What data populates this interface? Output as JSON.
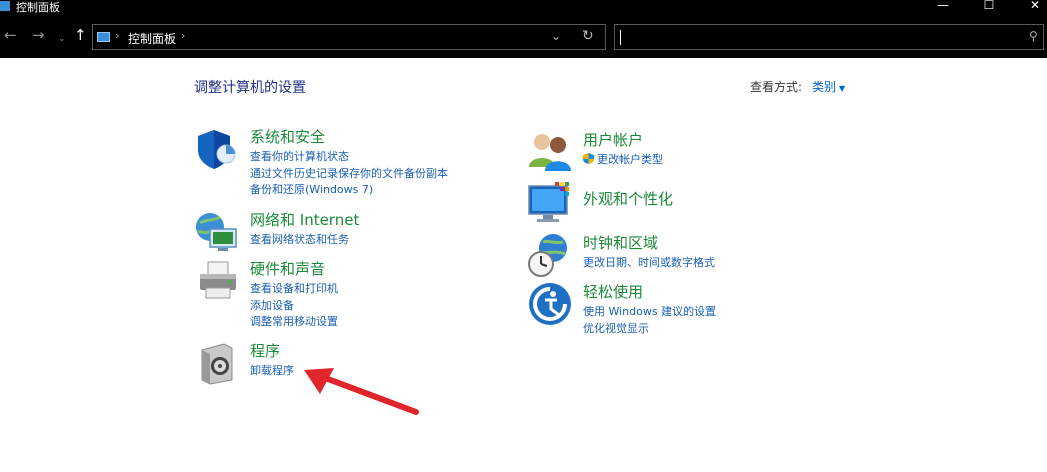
{
  "window": {
    "title": "控制面板",
    "minimize_glyph": "—",
    "maximize_glyph": "☐",
    "close_glyph": "✕"
  },
  "address_bar": {
    "back_glyph": "←",
    "forward_glyph": "→",
    "recent_glyph": "⌄",
    "up_glyph": "↑",
    "separator_glyph": "›",
    "breadcrumb": "控制面板",
    "dropdown_glyph": "⌄",
    "refresh_glyph": "↻",
    "search_value": "",
    "search_glyph": "⚲"
  },
  "header": {
    "title": "调整计算机的设置",
    "view_label": "查看方式:",
    "view_value": "类别",
    "view_arrow": "▼"
  },
  "categories_left": [
    {
      "title": "系统和安全",
      "icon": "shield-icon",
      "links": [
        "查看你的计算机状态",
        "通过文件历史记录保存你的文件备份副本",
        "备份和还原(Windows 7)"
      ]
    },
    {
      "title": "网络和 Internet",
      "icon": "network-globe-icon",
      "links": [
        "查看网络状态和任务"
      ]
    },
    {
      "title": "硬件和声音",
      "icon": "printer-icon",
      "links": [
        "查看设备和打印机",
        "添加设备",
        "调整常用移动设置"
      ]
    },
    {
      "title": "程序",
      "icon": "programs-disc-icon",
      "links": [
        "卸载程序"
      ]
    }
  ],
  "categories_right": [
    {
      "title": "用户帐户",
      "icon": "users-icon",
      "links": [
        "更改帐户类型"
      ]
    },
    {
      "title": "外观和个性化",
      "icon": "monitor-color-icon",
      "links": []
    },
    {
      "title": "时钟和区域",
      "icon": "clock-globe-icon",
      "links": [
        "更改日期、时间或数字格式"
      ]
    },
    {
      "title": "轻松使用",
      "icon": "ease-of-access-icon",
      "links": [
        "使用 Windows 建议的设置",
        "优化视觉显示"
      ]
    }
  ],
  "colors": {
    "title_bar": "#000000",
    "category_title": "#1c8a3a",
    "link": "#1a5fb4",
    "page_title": "#1e3287",
    "annotation_arrow": "#e0262b"
  }
}
